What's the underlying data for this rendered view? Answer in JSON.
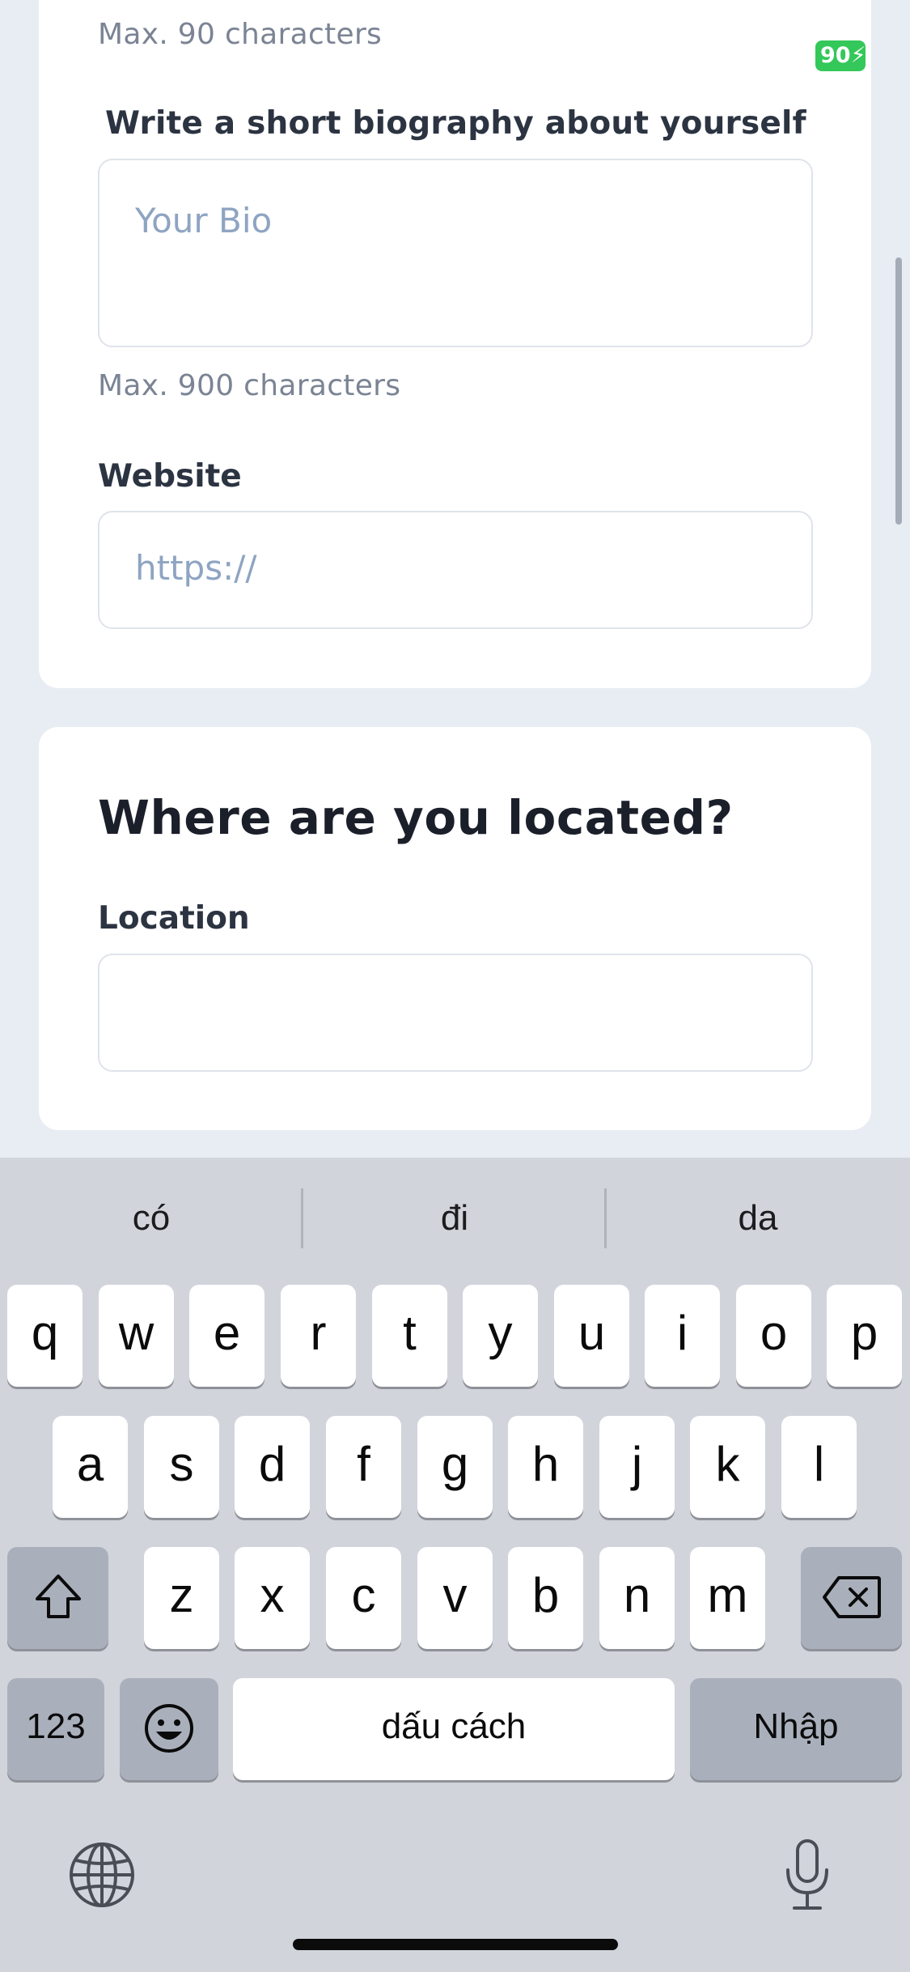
{
  "status": {
    "battery_text": "90⚡",
    "battery_color": "#34c759"
  },
  "form": {
    "title_hint": "Max. 90 characters",
    "bio": {
      "label": "Write a short biography about yourself",
      "placeholder": "Your Bio",
      "hint": "Max. 900 characters"
    },
    "website": {
      "label": "Website",
      "placeholder": "https://"
    }
  },
  "location_section": {
    "title": "Where are you located?",
    "location_label": "Location",
    "location_value": ""
  },
  "keyboard": {
    "suggestions": [
      "có",
      "đi",
      "da"
    ],
    "row1": [
      "q",
      "w",
      "e",
      "r",
      "t",
      "y",
      "u",
      "i",
      "o",
      "p"
    ],
    "row2": [
      "a",
      "s",
      "d",
      "f",
      "g",
      "h",
      "j",
      "k",
      "l"
    ],
    "row3": [
      "z",
      "x",
      "c",
      "v",
      "b",
      "n",
      "m"
    ],
    "numbers_label": "123",
    "space_label": "dấu cách",
    "return_label": "Nhập",
    "icons": {
      "shift": "shift-icon",
      "delete": "delete-icon",
      "emoji": "emoji-icon",
      "globe": "globe-icon",
      "microphone": "microphone-icon"
    }
  },
  "colors": {
    "page_background": "#e8edf4",
    "card_background": "#ffffff",
    "placeholder": "#8ea4c2",
    "keyboard_background": "#d1d4db"
  }
}
